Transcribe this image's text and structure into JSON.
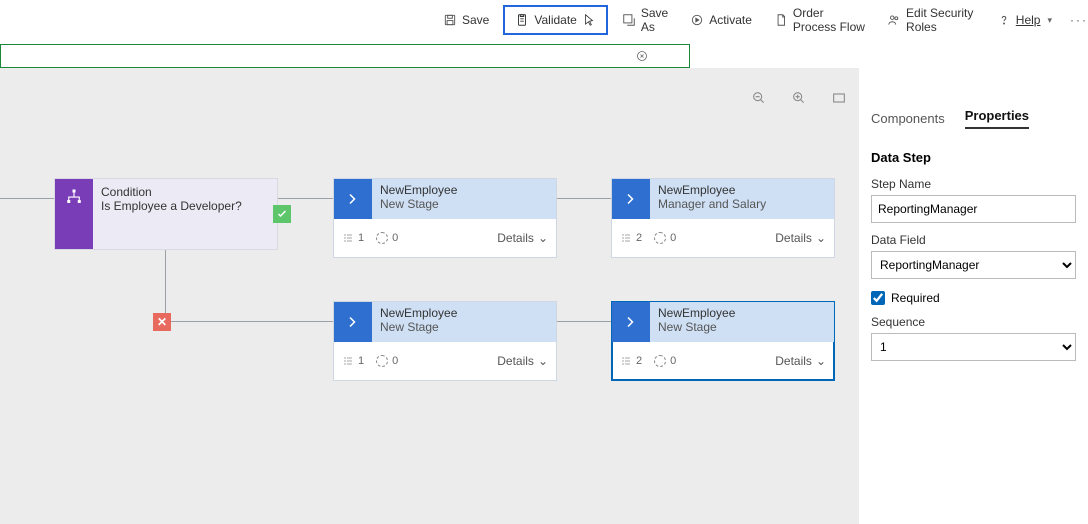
{
  "toolbar": {
    "save": "Save",
    "validate": "Validate",
    "save_as": "Save As",
    "activate": "Activate",
    "order": "Order Process Flow",
    "roles": "Edit Security Roles",
    "help": "Help"
  },
  "canvas": {
    "condition": {
      "title": "Condition",
      "subtitle": "Is Employee a Developer?"
    },
    "stages": [
      {
        "title": "NewEmployee",
        "subtitle": "New Stage",
        "steps": "1",
        "branch": "0",
        "details": "Details"
      },
      {
        "title": "NewEmployee",
        "subtitle": "Manager and Salary",
        "steps": "2",
        "branch": "0",
        "details": "Details"
      },
      {
        "title": "NewEmployee",
        "subtitle": "New Stage",
        "steps": "1",
        "branch": "0",
        "details": "Details"
      },
      {
        "title": "NewEmployee",
        "subtitle": "New Stage",
        "steps": "2",
        "branch": "0",
        "details": "Details"
      }
    ]
  },
  "panel": {
    "tab_components": "Components",
    "tab_properties": "Properties",
    "section_title": "Data Step",
    "step_name_label": "Step Name",
    "step_name_value": "ReportingManager",
    "data_field_label": "Data Field",
    "data_field_value": "ReportingManager",
    "required_label": "Required",
    "sequence_label": "Sequence",
    "sequence_value": "1"
  }
}
